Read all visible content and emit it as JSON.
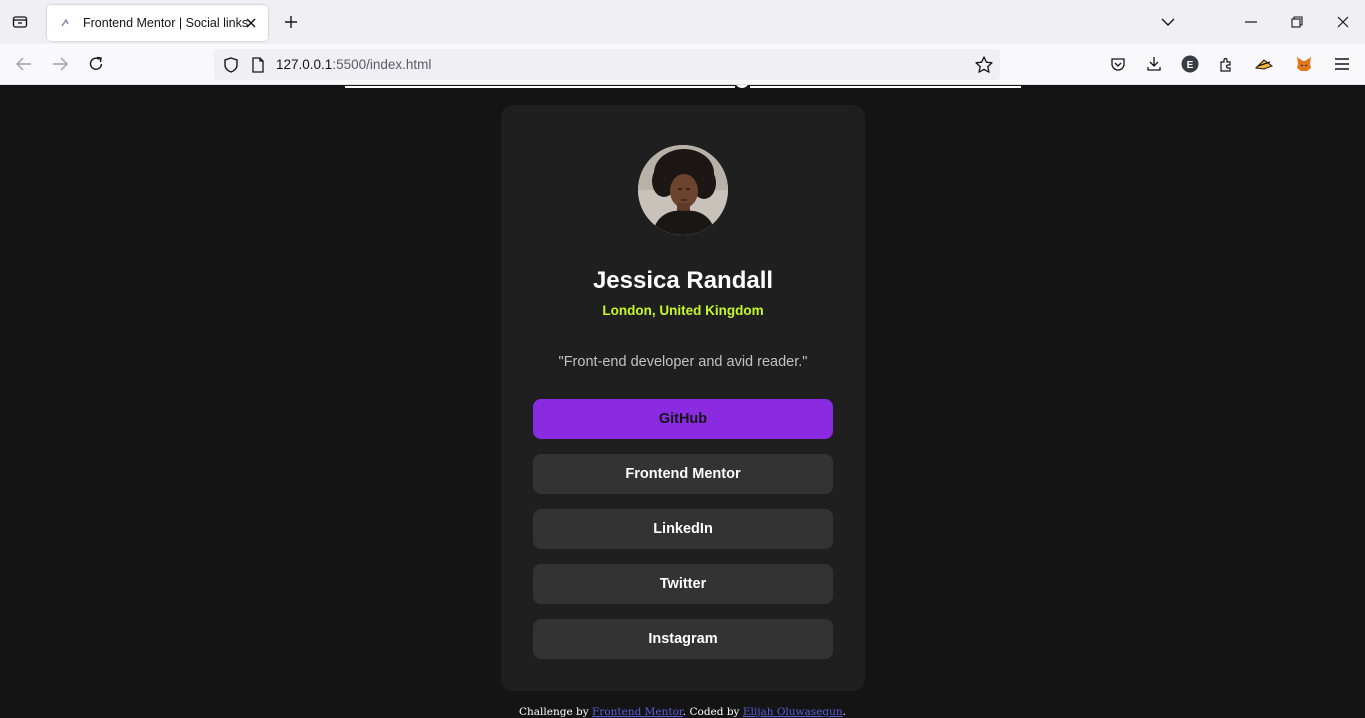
{
  "browser": {
    "tab_title": "Frontend Mentor | Social links profile",
    "url_host": "127.0.0.1",
    "url_path": ":5500/index.html",
    "icons": [
      "tab-list-icon",
      "favicon-icon",
      "close-tab-icon",
      "new-tab-icon",
      "list-tabs-icon",
      "minimize-icon",
      "restore-icon",
      "close-window-icon",
      "back-icon",
      "forward-icon",
      "reload-icon",
      "shield-icon",
      "page-icon",
      "bookmark-star-icon",
      "pocket-icon",
      "downloads-icon",
      "extension-e-icon",
      "extensions-icon",
      "extension-ghost-icon",
      "metamask-fox-icon",
      "menu-icon"
    ]
  },
  "profile": {
    "name": "Jessica Randall",
    "location": "London, United Kingdom",
    "bio": "\"Front-end developer and avid reader.\""
  },
  "links": [
    {
      "label": "GitHub",
      "active": true
    },
    {
      "label": "Frontend Mentor",
      "active": false
    },
    {
      "label": "LinkedIn",
      "active": false
    },
    {
      "label": "Twitter",
      "active": false
    },
    {
      "label": "Instagram",
      "active": false
    }
  ],
  "footer": {
    "prefix": "Challenge by ",
    "fm_link": "Frontend Mentor",
    "middle": ". Coded by ",
    "author_link": "Elijah Oluwasegun",
    "suffix": "."
  },
  "colors": {
    "page_bg": "#141414",
    "card_bg": "#1f1f1f",
    "button_bg": "#333333",
    "accent_green": "#c4f82a",
    "active_purple": "#8a2be2"
  }
}
